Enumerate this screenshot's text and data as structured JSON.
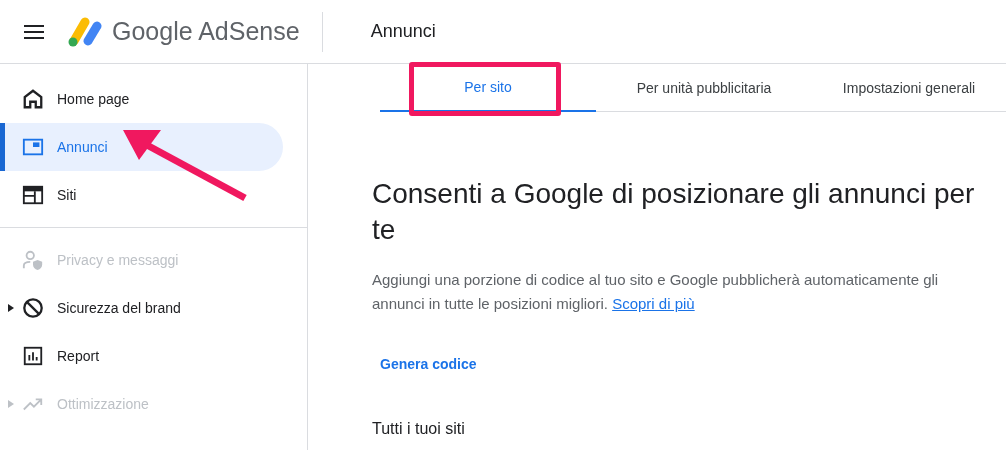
{
  "header": {
    "logo_text": "Google AdSense",
    "page_title": "Annunci"
  },
  "sidebar": {
    "sections": [
      {
        "items": [
          {
            "label": "Home page",
            "selected": false,
            "disabled": false,
            "expandable": false,
            "annotated": false
          },
          {
            "label": "Annunci",
            "selected": true,
            "disabled": false,
            "expandable": false,
            "annotated": true
          },
          {
            "label": "Siti",
            "selected": false,
            "disabled": false,
            "expandable": false,
            "annotated": false
          }
        ]
      },
      {
        "items": [
          {
            "label": "Privacy e messaggi",
            "selected": false,
            "disabled": true,
            "expandable": false,
            "annotated": false
          },
          {
            "label": "Sicurezza del brand",
            "selected": false,
            "disabled": false,
            "expandable": true,
            "annotated": false
          },
          {
            "label": "Report",
            "selected": false,
            "disabled": false,
            "expandable": false,
            "annotated": false
          },
          {
            "label": "Ottimizzazione",
            "selected": false,
            "disabled": true,
            "expandable": true,
            "annotated": false
          }
        ]
      }
    ]
  },
  "tabs": [
    {
      "label": "Per sito",
      "selected": true,
      "highlighted": true
    },
    {
      "label": "Per unità pubblicitaria",
      "selected": false,
      "highlighted": false
    },
    {
      "label": "Impostazioni generali",
      "selected": false,
      "highlighted": false
    }
  ],
  "content": {
    "heading": "Consenti a Google di posizionare gli annunci per te",
    "description": "Aggiungi una porzione di codice al tuo sito e Google pubblicherà automaticamente gli annunci in tutte le posizioni migliori.",
    "link": "Scopri di più",
    "action": "Genera codice",
    "section_title": "Tutti i tuoi siti"
  }
}
